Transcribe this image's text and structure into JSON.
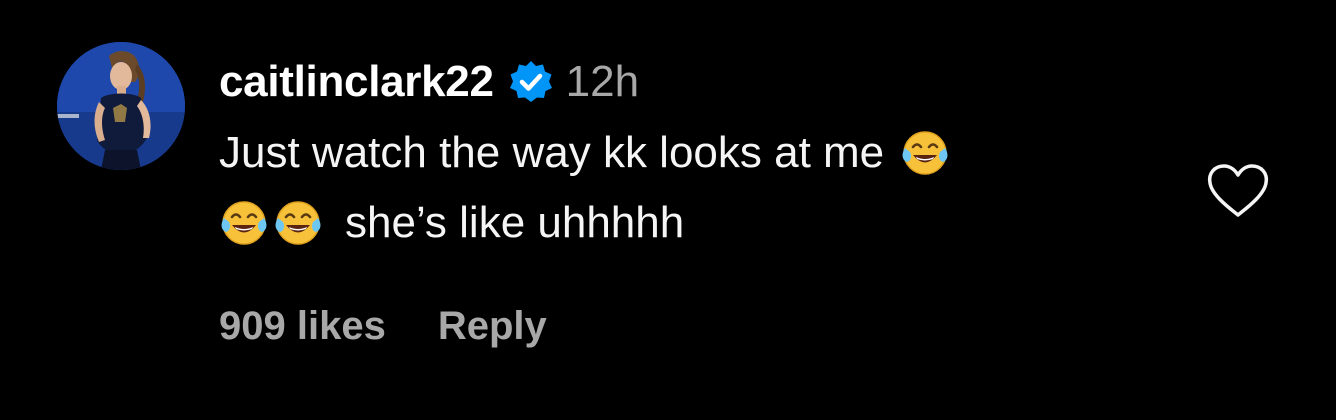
{
  "comment": {
    "username": "caitlinclark22",
    "verified_icon": "verified-badge-icon",
    "timestamp": "12h",
    "text_line1": "Just watch the way kk looks at me",
    "text_line2": "she’s like uhhhhh",
    "emoji_icon": "face-with-tears-of-joy-icon",
    "likes_label": "909 likes",
    "reply_label": "Reply",
    "like_icon": "heart-outline-icon"
  },
  "colors": {
    "background": "#000000",
    "primary_text": "#f5f5f5",
    "secondary_text": "#a8a8a8",
    "verified_blue": "#0095f6",
    "avatar_bg": "#1e46a8"
  }
}
